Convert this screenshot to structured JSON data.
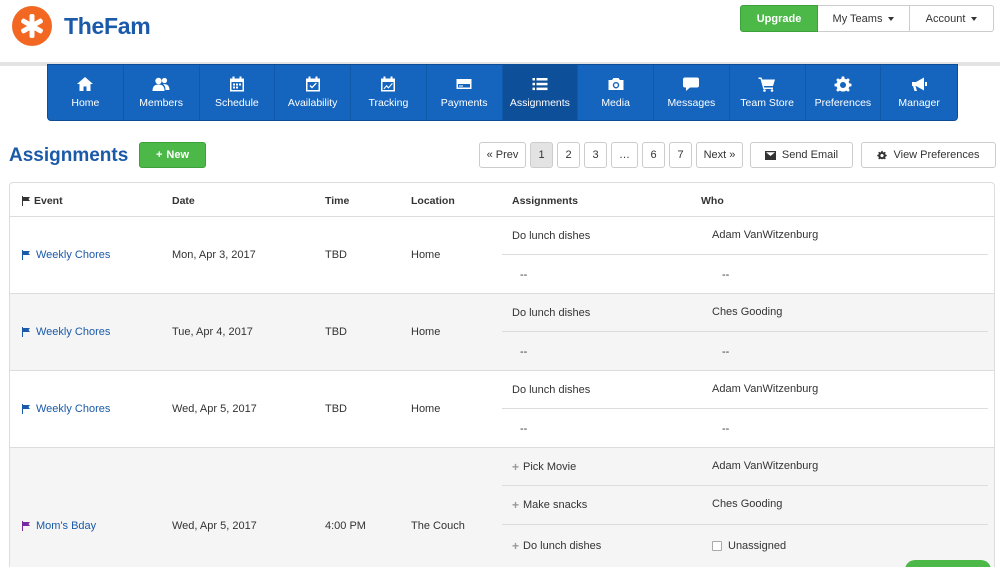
{
  "app": {
    "name": "TheFam"
  },
  "top_buttons": {
    "upgrade": "Upgrade",
    "my_teams": "My Teams",
    "account": "Account"
  },
  "nav": [
    {
      "label": "Home",
      "icon": "home-icon"
    },
    {
      "label": "Members",
      "icon": "members-icon"
    },
    {
      "label": "Schedule",
      "icon": "calendar-icon"
    },
    {
      "label": "Availability",
      "icon": "availability-icon"
    },
    {
      "label": "Tracking",
      "icon": "tracking-icon"
    },
    {
      "label": "Payments",
      "icon": "credit-card-icon"
    },
    {
      "label": "Assignments",
      "icon": "list-icon",
      "active": true
    },
    {
      "label": "Media",
      "icon": "camera-icon"
    },
    {
      "label": "Messages",
      "icon": "chat-icon"
    },
    {
      "label": "Team Store",
      "icon": "cart-icon"
    },
    {
      "label": "Preferences",
      "icon": "gear-icon"
    },
    {
      "label": "Manager",
      "icon": "megaphone-icon"
    }
  ],
  "page": {
    "title": "Assignments",
    "new_button": "New",
    "pagination": {
      "prev": "« Prev",
      "pages": [
        "1",
        "2",
        "3",
        "…",
        "6",
        "7"
      ],
      "current": "1",
      "next": "Next »"
    },
    "send_email": "Send Email",
    "view_preferences": "View Preferences"
  },
  "table": {
    "headers": [
      "Event",
      "Date",
      "Time",
      "Location",
      "Assignments",
      "Who"
    ],
    "rows": [
      {
        "event": "Weekly Chores",
        "date": "Mon, Apr 3, 2017",
        "time": "TBD",
        "location": "Home",
        "assignments": [
          {
            "task": "Do lunch dishes",
            "who": "Adam VanWitzenburg"
          },
          {
            "task": "--",
            "who": "--"
          }
        ]
      },
      {
        "event": "Weekly Chores",
        "date": "Tue, Apr 4, 2017",
        "time": "TBD",
        "location": "Home",
        "assignments": [
          {
            "task": "Do lunch dishes",
            "who": "Ches Gooding"
          },
          {
            "task": "--",
            "who": "--"
          }
        ]
      },
      {
        "event": "Weekly Chores",
        "date": "Wed, Apr 5, 2017",
        "time": "TBD",
        "location": "Home",
        "assignments": [
          {
            "task": "Do lunch dishes",
            "who": "Adam VanWitzenburg"
          },
          {
            "task": "--",
            "who": "--"
          }
        ]
      },
      {
        "event": "Mom's Bday",
        "date": "Wed, Apr 5, 2017",
        "time": "4:00 PM",
        "location": "The Couch",
        "assignments": [
          {
            "task": "Pick Movie",
            "who": "Adam VanWitzenburg"
          },
          {
            "task": "Make snacks",
            "who": "Ches Gooding"
          },
          {
            "task": "Do lunch dishes",
            "who": "Unassigned"
          }
        ]
      }
    ]
  },
  "colors": {
    "brand_blue": "#1565bf",
    "green": "#4cb848",
    "logo_orange": "#f26722"
  }
}
